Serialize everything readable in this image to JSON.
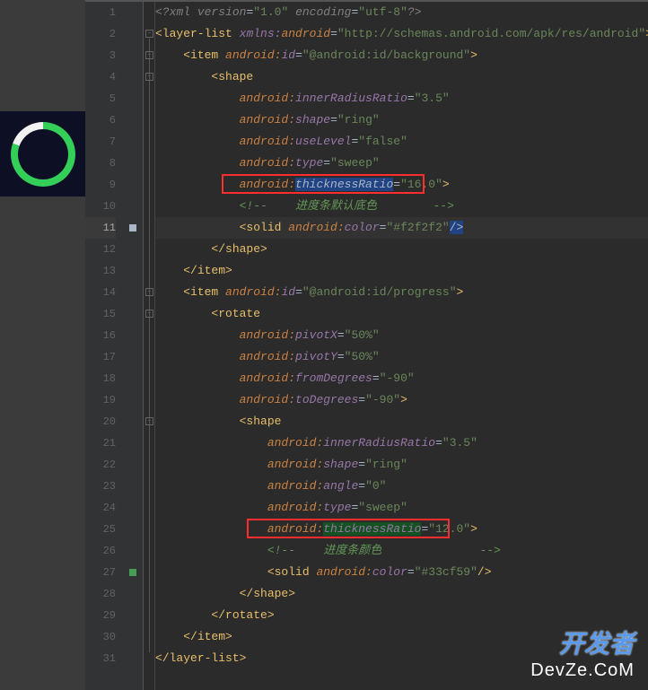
{
  "preview": {
    "progress_color": "#33cf59",
    "background_color": "#f2f2f2"
  },
  "code": {
    "l1_a": "<?",
    "l1_b": "xml version",
    "l1_c": "=",
    "l1_d": "\"1.0\"",
    "l1_e": " encoding",
    "l1_f": "=",
    "l1_g": "\"utf-8\"",
    "l1_h": "?>",
    "l2_a": "<",
    "l2_b": "layer-list ",
    "l2_c": "xmlns:",
    "l2_d": "android",
    "l2_e": "=",
    "l2_f": "\"http://schemas.android.com/apk/res/android\"",
    "l2_g": ">",
    "l3_a": "    <",
    "l3_b": "item ",
    "l3_c": "android:",
    "l3_d": "id",
    "l3_e": "=",
    "l3_f": "\"@android:id/background\"",
    "l3_g": ">",
    "l4_a": "        <",
    "l4_b": "shape",
    "l5_a": "            ",
    "l5_b": "android:",
    "l5_c": "innerRadiusRatio",
    "l5_d": "=",
    "l5_e": "\"3.5\"",
    "l6_a": "            ",
    "l6_b": "android:",
    "l6_c": "shape",
    "l6_d": "=",
    "l6_e": "\"ring\"",
    "l7_a": "            ",
    "l7_b": "android:",
    "l7_c": "useLevel",
    "l7_d": "=",
    "l7_e": "\"false\"",
    "l8_a": "            ",
    "l8_b": "android:",
    "l8_c": "type",
    "l8_d": "=",
    "l8_e": "\"sweep\"",
    "l9_a": "            ",
    "l9_b": "android:",
    "l9_c": "thicknessRatio",
    "l9_d": "=",
    "l9_e": "\"16.0\"",
    "l9_f": ">",
    "l10_a": "            ",
    "l10_b": "<!--",
    "l10_c": "    进度条默认底色        ",
    "l10_d": "-->",
    "l11_a": "            <",
    "l11_b": "solid ",
    "l11_c": "android:",
    "l11_d": "color",
    "l11_e": "=",
    "l11_f": "\"#f2f2f2\"",
    "l11_g": "/>",
    "l12_a": "        </",
    "l12_b": "shape",
    "l12_c": ">",
    "l13_a": "    </",
    "l13_b": "item",
    "l13_c": ">",
    "l14_a": "    <",
    "l14_b": "item ",
    "l14_c": "android:",
    "l14_d": "id",
    "l14_e": "=",
    "l14_f": "\"@android:id/progress\"",
    "l14_g": ">",
    "l15_a": "        <",
    "l15_b": "rotate",
    "l16_a": "            ",
    "l16_b": "android:",
    "l16_c": "pivotX",
    "l16_d": "=",
    "l16_e": "\"50%\"",
    "l17_a": "            ",
    "l17_b": "android:",
    "l17_c": "pivotY",
    "l17_d": "=",
    "l17_e": "\"50%\"",
    "l18_a": "            ",
    "l18_b": "android:",
    "l18_c": "fromDegrees",
    "l18_d": "=",
    "l18_e": "\"-90\"",
    "l19_a": "            ",
    "l19_b": "android:",
    "l19_c": "toDegrees",
    "l19_d": "=",
    "l19_e": "\"-90\"",
    "l19_f": ">",
    "l20_a": "            <",
    "l20_b": "shape",
    "l21_a": "                ",
    "l21_b": "android:",
    "l21_c": "innerRadiusRatio",
    "l21_d": "=",
    "l21_e": "\"3.5\"",
    "l22_a": "                ",
    "l22_b": "android:",
    "l22_c": "shape",
    "l22_d": "=",
    "l22_e": "\"ring\"",
    "l23_a": "                ",
    "l23_b": "android:",
    "l23_c": "angle",
    "l23_d": "=",
    "l23_e": "\"0\"",
    "l24_a": "                ",
    "l24_b": "android:",
    "l24_c": "type",
    "l24_d": "=",
    "l24_e": "\"sweep\"",
    "l25_a": "                ",
    "l25_b": "android:",
    "l25_c": "thicknessRatio",
    "l25_d": "=",
    "l25_e": "\"12.0\"",
    "l25_f": ">",
    "l26_a": "                ",
    "l26_b": "<!--",
    "l26_c": "    进度条颜色              ",
    "l26_d": "-->",
    "l27_a": "                <",
    "l27_b": "solid ",
    "l27_c": "android:",
    "l27_d": "color",
    "l27_e": "=",
    "l27_f": "\"#33cf59\"",
    "l27_g": "/>",
    "l28_a": "            </",
    "l28_b": "shape",
    "l28_c": ">",
    "l29_a": "        </",
    "l29_b": "rotate",
    "l29_c": ">",
    "l30_a": "    </",
    "l30_b": "item",
    "l30_c": ">",
    "l31_a": "</",
    "l31_b": "layer-list",
    "l31_c": ">"
  },
  "watermark": {
    "top": "开发者",
    "bottom": "DevZe.CoM"
  },
  "gutter": [
    "1",
    "2",
    "3",
    "4",
    "5",
    "6",
    "7",
    "8",
    "9",
    "10",
    "11",
    "12",
    "13",
    "14",
    "15",
    "16",
    "17",
    "18",
    "19",
    "20",
    "21",
    "22",
    "23",
    "24",
    "25",
    "26",
    "27",
    "28",
    "29",
    "30",
    "31"
  ]
}
